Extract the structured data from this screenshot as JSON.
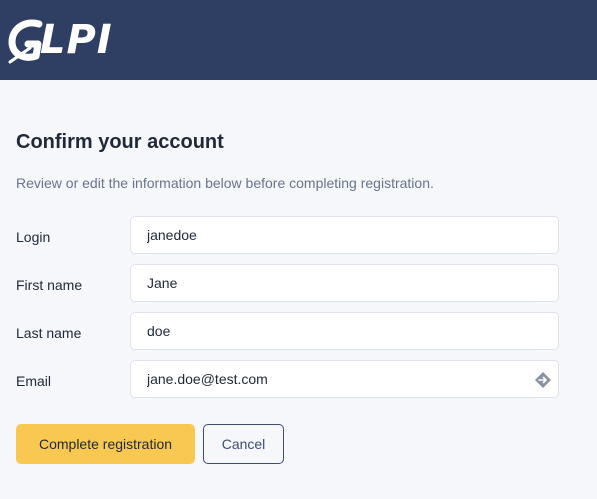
{
  "header": {
    "logo_text": "LPI",
    "logo_icon": "glpi-g-icon",
    "background": "#2f3f64"
  },
  "form": {
    "title": "Confirm your account",
    "subtitle": "Review or edit the information below before completing registration.",
    "fields": [
      {
        "label": "Login",
        "value": "janedoe"
      },
      {
        "label": "First name",
        "value": "Jane"
      },
      {
        "label": "Last name",
        "value": "doe"
      },
      {
        "label": "Email",
        "value": "jane.doe@test.com",
        "icon": "autofill-icon"
      }
    ]
  },
  "actions": {
    "submit_label": "Complete registration",
    "cancel_label": "Cancel",
    "submit_color": "#f9c851",
    "cancel_color": "#3d4d72"
  }
}
